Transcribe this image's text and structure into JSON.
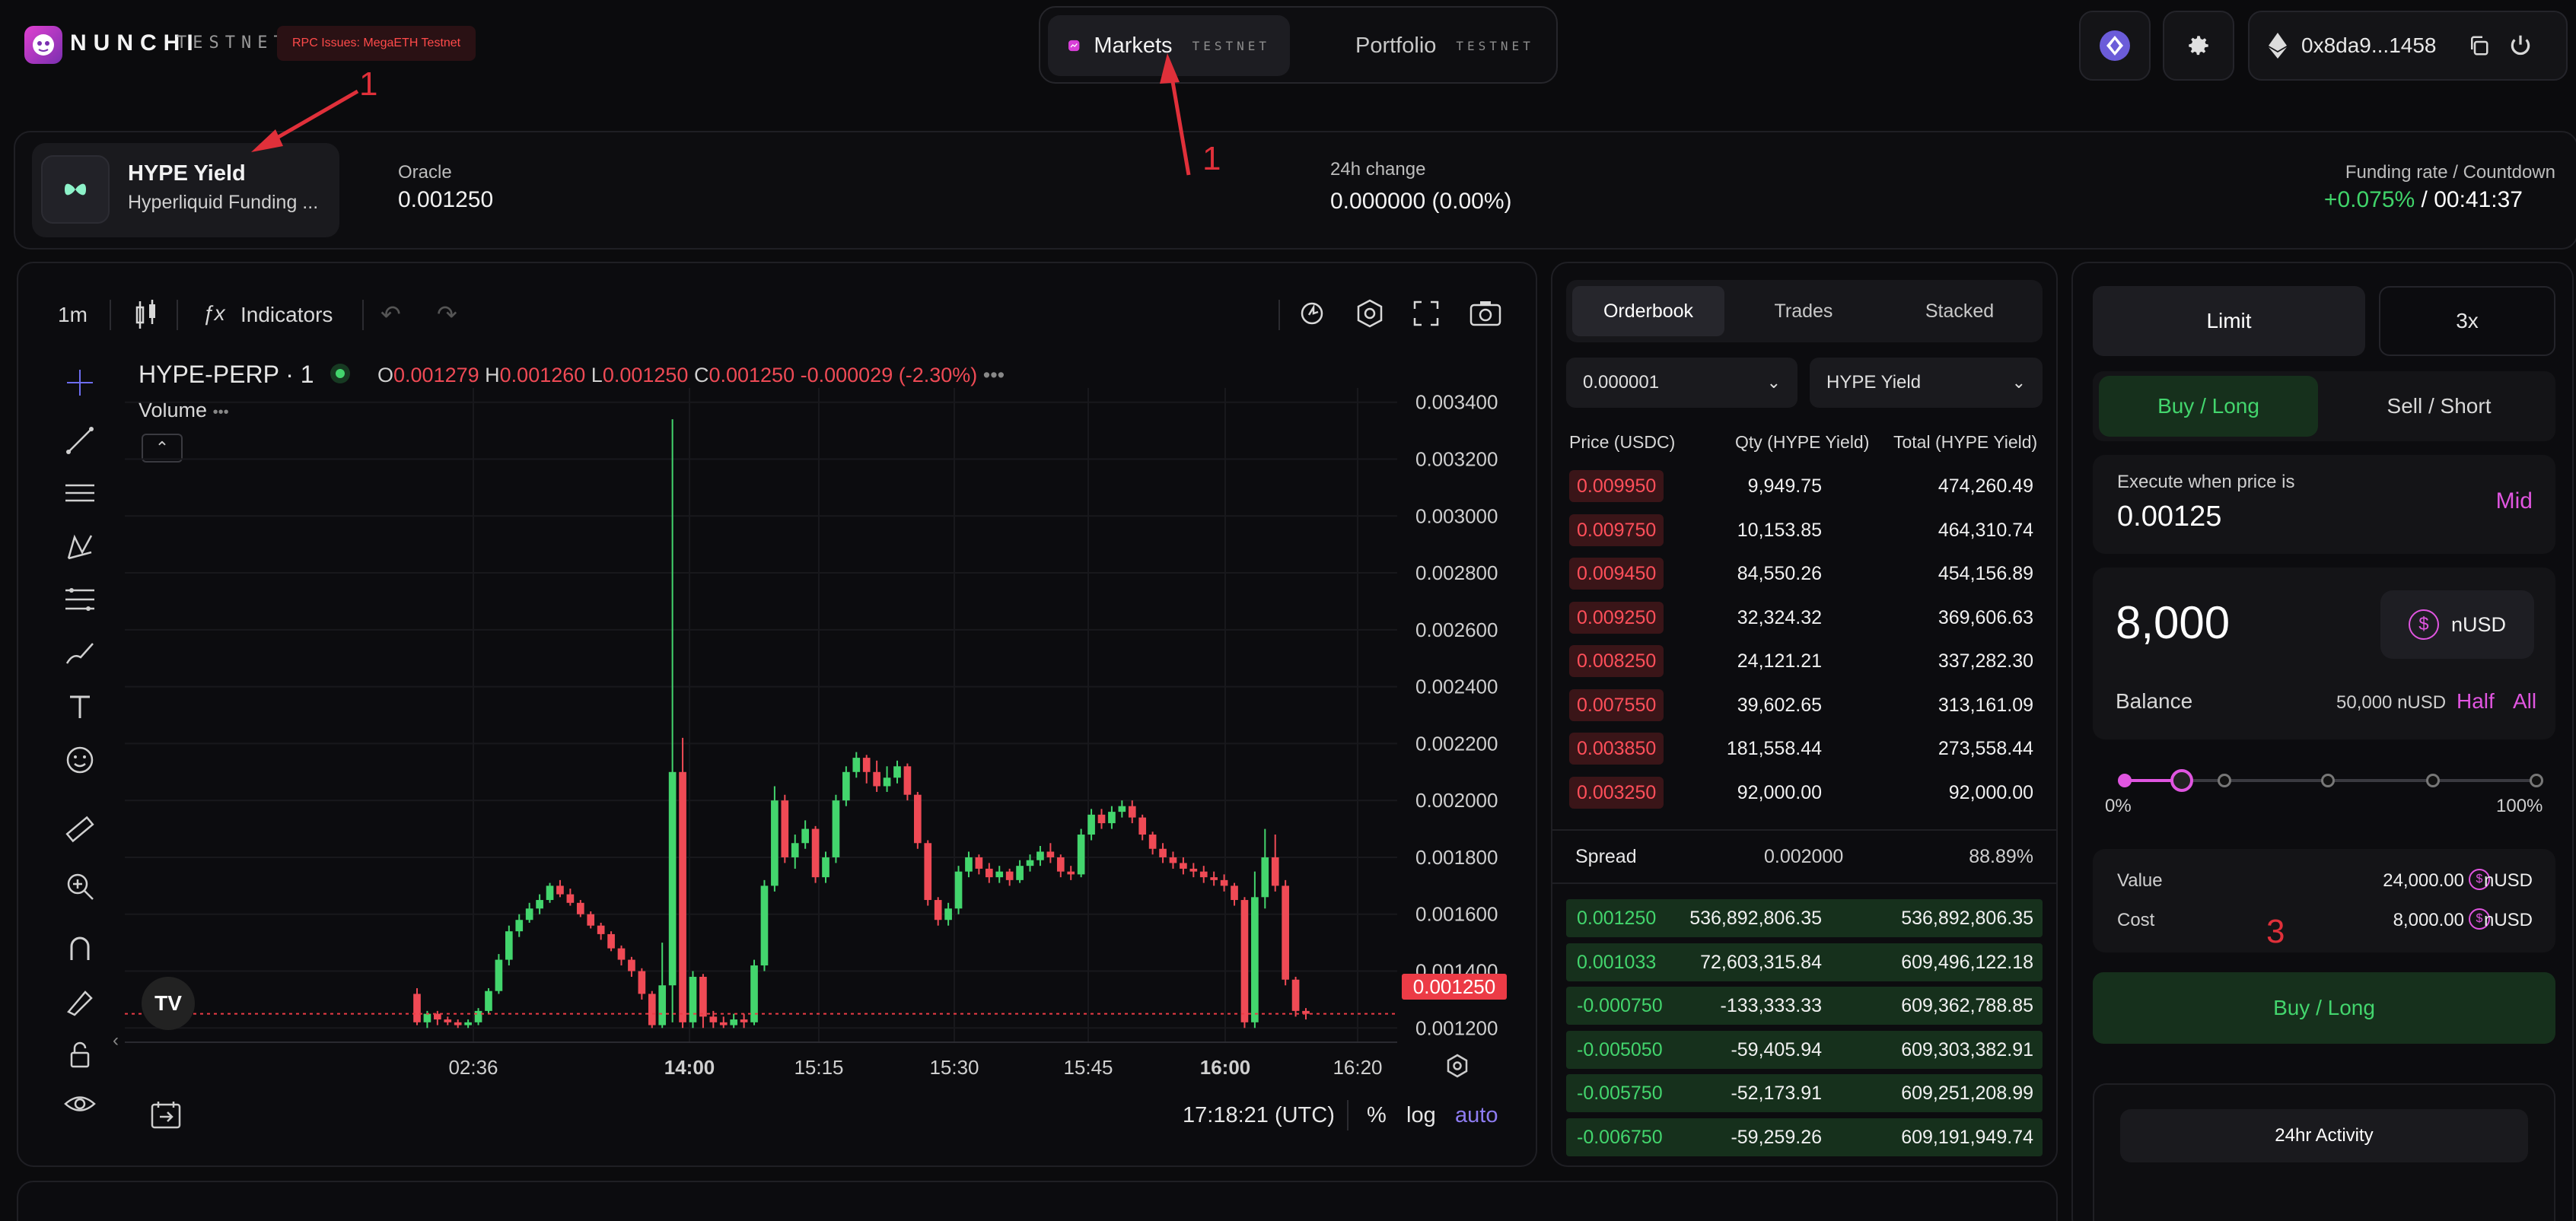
{
  "brand": {
    "name": "NUNCHI",
    "network": "TESTNET",
    "rpc_badge": "RPC Issues: MegaETH Testnet"
  },
  "nav": {
    "tabs": [
      {
        "label": "Markets",
        "sub": "TESTNET",
        "active": true
      },
      {
        "label": "Portfolio",
        "sub": "TESTNET",
        "active": false
      }
    ]
  },
  "wallet": {
    "address": "0x8da9...1458"
  },
  "market": {
    "name": "HYPE Yield",
    "subtitle": "Hyperliquid Funding ...",
    "oracle_label": "Oracle",
    "oracle_value": "0.001250",
    "change_label": "24h change",
    "change_value": "0.000000 (0.00%)",
    "funding_label": "Funding rate / Countdown",
    "funding_rate": "+0.075%",
    "funding_sep": " / ",
    "countdown": "00:41:37"
  },
  "chart_toolbar": {
    "interval": "1m",
    "indicators": "Indicators"
  },
  "chart_legend": {
    "symbol": "HYPE-PERP · 1",
    "o_label": "O",
    "o": "0.001279",
    "h_label": "H",
    "h": "0.001260",
    "l_label": "L",
    "l": "0.001250",
    "c_label": "C",
    "c": "0.001250",
    "change": "-0.000029 (-2.30%)",
    "volume": "Volume"
  },
  "chart_footer": {
    "time": "17:18:21 (UTC)",
    "pct": "%",
    "log": "log",
    "auto": "auto"
  },
  "last_price_tag": "0.001250",
  "colors": {
    "up": "#43d56d",
    "down": "#ef4a55",
    "accent": "#e055e0",
    "background": "#0b0b0d"
  },
  "chart_data": {
    "type": "candlestick",
    "y_axis_ticks": [
      "0.003400",
      "0.003200",
      "0.003000",
      "0.002800",
      "0.002600",
      "0.002400",
      "0.002200",
      "0.002000",
      "0.001800",
      "0.001600",
      "0.001400",
      "0.001200"
    ],
    "x_axis_ticks": [
      "02:36",
      "14:00",
      "15:15",
      "15:30",
      "15:45",
      "16:00",
      "16:20"
    ],
    "ylim": [
      0.00115,
      0.00345
    ],
    "candles": [
      {
        "o": 0.00132,
        "c": 0.00122,
        "h": 0.00134,
        "l": 0.00121
      },
      {
        "o": 0.00122,
        "c": 0.00125,
        "h": 0.00126,
        "l": 0.0012
      },
      {
        "o": 0.00125,
        "c": 0.00123,
        "h": 0.00126,
        "l": 0.00121
      },
      {
        "o": 0.00123,
        "c": 0.00122,
        "h": 0.00124,
        "l": 0.00121
      },
      {
        "o": 0.00122,
        "c": 0.00121,
        "h": 0.00123,
        "l": 0.0012
      },
      {
        "o": 0.00121,
        "c": 0.00122,
        "h": 0.00123,
        "l": 0.0012
      },
      {
        "o": 0.00122,
        "c": 0.00126,
        "h": 0.00127,
        "l": 0.00121
      },
      {
        "o": 0.00126,
        "c": 0.00133,
        "h": 0.00134,
        "l": 0.00125
      },
      {
        "o": 0.00133,
        "c": 0.00144,
        "h": 0.00146,
        "l": 0.00132
      },
      {
        "o": 0.00144,
        "c": 0.00154,
        "h": 0.00156,
        "l": 0.00142
      },
      {
        "o": 0.00154,
        "c": 0.00158,
        "h": 0.0016,
        "l": 0.00152
      },
      {
        "o": 0.00158,
        "c": 0.00162,
        "h": 0.00164,
        "l": 0.00157
      },
      {
        "o": 0.00162,
        "c": 0.00165,
        "h": 0.00167,
        "l": 0.0016
      },
      {
        "o": 0.00165,
        "c": 0.0017,
        "h": 0.00171,
        "l": 0.00164
      },
      {
        "o": 0.0017,
        "c": 0.00167,
        "h": 0.00172,
        "l": 0.00166
      },
      {
        "o": 0.00167,
        "c": 0.00164,
        "h": 0.00169,
        "l": 0.00163
      },
      {
        "o": 0.00164,
        "c": 0.0016,
        "h": 0.00165,
        "l": 0.00159
      },
      {
        "o": 0.0016,
        "c": 0.00156,
        "h": 0.00161,
        "l": 0.00155
      },
      {
        "o": 0.00156,
        "c": 0.00153,
        "h": 0.00157,
        "l": 0.00151
      },
      {
        "o": 0.00153,
        "c": 0.00148,
        "h": 0.00154,
        "l": 0.00147
      },
      {
        "o": 0.00148,
        "c": 0.00144,
        "h": 0.00149,
        "l": 0.00142
      },
      {
        "o": 0.00144,
        "c": 0.0014,
        "h": 0.00145,
        "l": 0.00138
      },
      {
        "o": 0.0014,
        "c": 0.00132,
        "h": 0.00141,
        "l": 0.0013
      },
      {
        "o": 0.00132,
        "c": 0.00121,
        "h": 0.00133,
        "l": 0.0012
      },
      {
        "o": 0.00121,
        "c": 0.00135,
        "h": 0.0015,
        "l": 0.0012
      },
      {
        "o": 0.00135,
        "c": 0.0021,
        "h": 0.00334,
        "l": 0.00122
      },
      {
        "o": 0.0021,
        "c": 0.00122,
        "h": 0.00222,
        "l": 0.0012
      },
      {
        "o": 0.00122,
        "c": 0.00138,
        "h": 0.0014,
        "l": 0.0012
      },
      {
        "o": 0.00138,
        "c": 0.00124,
        "h": 0.00139,
        "l": 0.0012
      },
      {
        "o": 0.00124,
        "c": 0.00122,
        "h": 0.00126,
        "l": 0.0012
      },
      {
        "o": 0.00122,
        "c": 0.00121,
        "h": 0.00124,
        "l": 0.0012
      },
      {
        "o": 0.00121,
        "c": 0.00123,
        "h": 0.00125,
        "l": 0.0012
      },
      {
        "o": 0.00123,
        "c": 0.00122,
        "h": 0.00125,
        "l": 0.0012
      },
      {
        "o": 0.00122,
        "c": 0.00142,
        "h": 0.00144,
        "l": 0.00121
      },
      {
        "o": 0.00142,
        "c": 0.0017,
        "h": 0.00172,
        "l": 0.0014
      },
      {
        "o": 0.0017,
        "c": 0.002,
        "h": 0.00205,
        "l": 0.00168
      },
      {
        "o": 0.002,
        "c": 0.0018,
        "h": 0.00202,
        "l": 0.00178
      },
      {
        "o": 0.0018,
        "c": 0.00185,
        "h": 0.00188,
        "l": 0.00176
      },
      {
        "o": 0.00185,
        "c": 0.0019,
        "h": 0.00193,
        "l": 0.00183
      },
      {
        "o": 0.0019,
        "c": 0.00173,
        "h": 0.00191,
        "l": 0.00171
      },
      {
        "o": 0.00173,
        "c": 0.0018,
        "h": 0.00182,
        "l": 0.00171
      },
      {
        "o": 0.0018,
        "c": 0.002,
        "h": 0.00202,
        "l": 0.00178
      },
      {
        "o": 0.002,
        "c": 0.0021,
        "h": 0.00212,
        "l": 0.00198
      },
      {
        "o": 0.0021,
        "c": 0.00215,
        "h": 0.00217,
        "l": 0.00208
      },
      {
        "o": 0.00215,
        "c": 0.0021,
        "h": 0.00216,
        "l": 0.00206
      },
      {
        "o": 0.0021,
        "c": 0.00205,
        "h": 0.00214,
        "l": 0.00203
      },
      {
        "o": 0.00205,
        "c": 0.00208,
        "h": 0.00212,
        "l": 0.00203
      },
      {
        "o": 0.00208,
        "c": 0.00212,
        "h": 0.00214,
        "l": 0.00206
      },
      {
        "o": 0.00212,
        "c": 0.00202,
        "h": 0.00213,
        "l": 0.002
      },
      {
        "o": 0.00202,
        "c": 0.00185,
        "h": 0.00203,
        "l": 0.00183
      },
      {
        "o": 0.00185,
        "c": 0.00165,
        "h": 0.00186,
        "l": 0.00163
      },
      {
        "o": 0.00165,
        "c": 0.00158,
        "h": 0.00166,
        "l": 0.00156
      },
      {
        "o": 0.00158,
        "c": 0.00162,
        "h": 0.00164,
        "l": 0.00156
      },
      {
        "o": 0.00162,
        "c": 0.00175,
        "h": 0.00177,
        "l": 0.0016
      },
      {
        "o": 0.00175,
        "c": 0.0018,
        "h": 0.00182,
        "l": 0.00173
      },
      {
        "o": 0.0018,
        "c": 0.00176,
        "h": 0.00181,
        "l": 0.00174
      },
      {
        "o": 0.00176,
        "c": 0.00173,
        "h": 0.00178,
        "l": 0.00171
      },
      {
        "o": 0.00173,
        "c": 0.00175,
        "h": 0.00177,
        "l": 0.00171
      },
      {
        "o": 0.00175,
        "c": 0.00172,
        "h": 0.00176,
        "l": 0.0017
      },
      {
        "o": 0.00172,
        "c": 0.00177,
        "h": 0.00179,
        "l": 0.00171
      },
      {
        "o": 0.00177,
        "c": 0.00179,
        "h": 0.00181,
        "l": 0.00175
      },
      {
        "o": 0.00179,
        "c": 0.00182,
        "h": 0.00184,
        "l": 0.00177
      },
      {
        "o": 0.00182,
        "c": 0.0018,
        "h": 0.00185,
        "l": 0.00178
      },
      {
        "o": 0.0018,
        "c": 0.00175,
        "h": 0.00181,
        "l": 0.00173
      },
      {
        "o": 0.00175,
        "c": 0.00174,
        "h": 0.00177,
        "l": 0.00172
      },
      {
        "o": 0.00174,
        "c": 0.00188,
        "h": 0.0019,
        "l": 0.00173
      },
      {
        "o": 0.00188,
        "c": 0.00195,
        "h": 0.00197,
        "l": 0.00186
      },
      {
        "o": 0.00195,
        "c": 0.00192,
        "h": 0.00197,
        "l": 0.0019
      },
      {
        "o": 0.00192,
        "c": 0.00196,
        "h": 0.00198,
        "l": 0.0019
      },
      {
        "o": 0.00196,
        "c": 0.00198,
        "h": 0.002,
        "l": 0.00194
      },
      {
        "o": 0.00198,
        "c": 0.00194,
        "h": 0.002,
        "l": 0.00192
      },
      {
        "o": 0.00194,
        "c": 0.00188,
        "h": 0.00195,
        "l": 0.00186
      },
      {
        "o": 0.00188,
        "c": 0.00183,
        "h": 0.00189,
        "l": 0.00181
      },
      {
        "o": 0.00183,
        "c": 0.0018,
        "h": 0.00185,
        "l": 0.00178
      },
      {
        "o": 0.0018,
        "c": 0.00178,
        "h": 0.00182,
        "l": 0.00176
      },
      {
        "o": 0.00178,
        "c": 0.00176,
        "h": 0.0018,
        "l": 0.00174
      },
      {
        "o": 0.00176,
        "c": 0.00175,
        "h": 0.00178,
        "l": 0.00173
      },
      {
        "o": 0.00175,
        "c": 0.00173,
        "h": 0.00177,
        "l": 0.00171
      },
      {
        "o": 0.00173,
        "c": 0.00172,
        "h": 0.00175,
        "l": 0.0017
      },
      {
        "o": 0.00172,
        "c": 0.0017,
        "h": 0.00174,
        "l": 0.00168
      },
      {
        "o": 0.0017,
        "c": 0.00165,
        "h": 0.00171,
        "l": 0.00163
      },
      {
        "o": 0.00165,
        "c": 0.00122,
        "h": 0.00166,
        "l": 0.0012
      },
      {
        "o": 0.00122,
        "c": 0.00166,
        "h": 0.00175,
        "l": 0.0012
      },
      {
        "o": 0.00166,
        "c": 0.0018,
        "h": 0.0019,
        "l": 0.00162
      },
      {
        "o": 0.0018,
        "c": 0.0017,
        "h": 0.00188,
        "l": 0.00168
      },
      {
        "o": 0.0017,
        "c": 0.00137,
        "h": 0.00172,
        "l": 0.00135
      },
      {
        "o": 0.00137,
        "c": 0.00126,
        "h": 0.00138,
        "l": 0.00124
      },
      {
        "o": 0.00126,
        "c": 0.00125,
        "h": 0.00127,
        "l": 0.00123
      }
    ]
  },
  "orderbook": {
    "tabs": [
      "Orderbook",
      "Trades",
      "Stacked"
    ],
    "tick_select": "0.000001",
    "market_select": "HYPE Yield",
    "headers": [
      "Price (USDC)",
      "Qty (HYPE Yield)",
      "Total (HYPE Yield)"
    ],
    "asks": [
      {
        "price": "0.009950",
        "qty": "9,949.75",
        "total": "474,260.49"
      },
      {
        "price": "0.009750",
        "qty": "10,153.85",
        "total": "464,310.74"
      },
      {
        "price": "0.009450",
        "qty": "84,550.26",
        "total": "454,156.89"
      },
      {
        "price": "0.009250",
        "qty": "32,324.32",
        "total": "369,606.63"
      },
      {
        "price": "0.008250",
        "qty": "24,121.21",
        "total": "337,282.30"
      },
      {
        "price": "0.007550",
        "qty": "39,602.65",
        "total": "313,161.09"
      },
      {
        "price": "0.003850",
        "qty": "181,558.44",
        "total": "273,558.44"
      },
      {
        "price": "0.003250",
        "qty": "92,000.00",
        "total": "92,000.00"
      }
    ],
    "spread_label": "Spread",
    "spread_value": "0.002000",
    "spread_pct": "88.89%",
    "bids": [
      {
        "price": "0.001250",
        "qty": "536,892,806.35",
        "total": "536,892,806.35"
      },
      {
        "price": "0.001033",
        "qty": "72,603,315.84",
        "total": "609,496,122.18"
      },
      {
        "price": "-0.000750",
        "qty": "-133,333.33",
        "total": "609,362,788.85"
      },
      {
        "price": "-0.005050",
        "qty": "-59,405.94",
        "total": "609,303,382.91"
      },
      {
        "price": "-0.005750",
        "qty": "-52,173.91",
        "total": "609,251,208.99"
      },
      {
        "price": "-0.006750",
        "qty": "-59,259.26",
        "total": "609,191,949.74"
      }
    ]
  },
  "trade": {
    "order_type": "Limit",
    "leverage": "3x",
    "side_buy": "Buy / Long",
    "side_sell": "Sell / Short",
    "execute_label": "Execute when price is",
    "execute_price": "0.00125",
    "mid_label": "Mid",
    "amount": "8,000",
    "currency": "nUSD",
    "balance_label": "Balance",
    "balance_value": "50,000 nUSD",
    "half_label": "Half",
    "all_label": "All",
    "slider_min": "0%",
    "slider_max": "100%",
    "slider_value": 0.14,
    "value_label": "Value",
    "value_amount": "24,000.00",
    "cost_label": "Cost",
    "cost_amount": "8,000.00",
    "submit_label": "Buy / Long",
    "activity_label": "24hr Activity"
  },
  "annotations": {
    "one": "1",
    "three": "3"
  }
}
